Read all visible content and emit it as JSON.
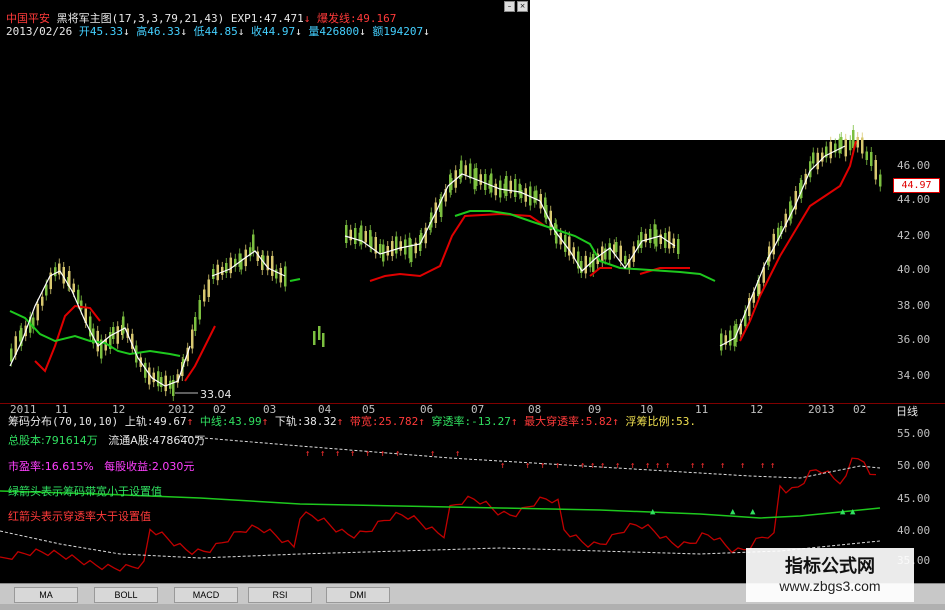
{
  "header": {
    "stock_name": "中国平安",
    "indicator_name": "黑将军主图(17,3,3,79,21,43)",
    "exp_label": "EXP1:47.471",
    "arrow": "↓",
    "burst_label": "爆发线:49.167",
    "date": "2013/02/26",
    "open": "开45.33",
    "high": "高46.33",
    "low": "低44.85",
    "close": "收44.97",
    "volume": "量426800",
    "amount": "额194207"
  },
  "price_axis": {
    "ticks": [
      "46.00",
      "44.00",
      "42.00",
      "40.00",
      "38.00",
      "36.00",
      "34.00"
    ],
    "current_price": "44.97"
  },
  "low_marker": "33.04",
  "time_axis": {
    "labels": [
      "2011",
      "11",
      "12",
      "2012",
      "02",
      "03",
      "04",
      "05",
      "06",
      "07",
      "08",
      "09",
      "10",
      "11",
      "12",
      "2013",
      "02"
    ],
    "period": "日线"
  },
  "indicator": {
    "name": "筹码分布(70,10,10)",
    "upper": "上轨:49.67",
    "mid": "中线:43.99",
    "lower": "下轨:38.32",
    "width": "带宽:25.782",
    "penetration": "穿透率:-13.27",
    "max_pen": "最大穿透率:5.82",
    "float_ratio": "浮筹比例:53.",
    "total_shares": "总股本:791614万",
    "float_a": "流通A股:478640万",
    "pe": "市盈率:16.615%",
    "eps": "每股收益:2.030元",
    "note_green": "绿箭头表示筹码带宽小于设置值",
    "note_red": "红箭头表示穿透率大于设置值",
    "axis_ticks": [
      "55.00",
      "50.00",
      "45.00",
      "40.00",
      "35.00"
    ]
  },
  "tabs": [
    "MA",
    "BOLL",
    "MACD",
    "RSI",
    "DMI"
  ],
  "watermark": {
    "line1": "指标公式网",
    "line2": "www.zbgs3.com"
  }
}
